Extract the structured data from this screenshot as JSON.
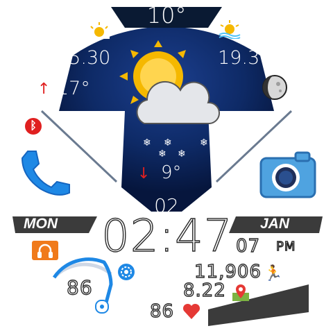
{
  "top_temperature": "10°",
  "sunrise_time": "05.30",
  "sunset_time": "19.30",
  "high_temperature": "17°",
  "low_temperature": "9°",
  "date_day": "02",
  "weekday": "MON",
  "month": "JAN",
  "time": "02:47",
  "seconds": "07",
  "ampm": "PM",
  "steps": "11,906",
  "distance": "8.22",
  "battery": "86",
  "heart_rate": "86",
  "battery_level_percent": 86,
  "colors": {
    "sky_blue": "#0e2a66",
    "accent_blue": "#1e88e5",
    "sun_yellow": "#f5b800",
    "red": "#e02020",
    "orange": "#f07a1a",
    "banner_dark": "#3b3b3b"
  },
  "icons": {
    "weather": "partly-cloudy-snow-icon",
    "sunrise": "sunrise-icon",
    "sunset": "sunset-icon",
    "moon": "moon-phase-icon",
    "phone": "phone-icon",
    "camera": "camera-icon",
    "bluetooth": "bluetooth-icon",
    "music": "headphones-icon",
    "settings": "gear-icon",
    "steps": "running-man-icon",
    "distance": "map-pin-icon",
    "heart": "heart-icon"
  }
}
